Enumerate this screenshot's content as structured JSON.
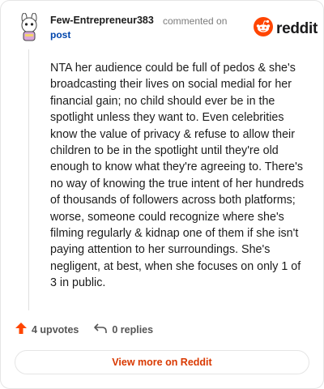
{
  "header": {
    "username": "Few-Entrepreneur383",
    "action_text": "commented on",
    "post_link": "post",
    "avatar_icon": "snoo-avatar-icon",
    "brand_icon": "reddit-snoo-icon",
    "brand_text": "reddit"
  },
  "comment": {
    "body": "NTA her audience could be full of pedos & she's broadcasting their lives on social medial for her financial gain; no child should ever be in the spotlight unless they want to. Even celebrities know the value of privacy & refuse to allow their children to be in the spotlight until they're old enough to know what they're agreeing to. There's no way of knowing the true intent of her hundreds of thousands of followers across both platforms; worse, someone could recognize where she's filming regularly & kidnap one of them if she isn't paying attention to her surroundings. She's negligent, at best, when she focuses on only 1 of 3 in public."
  },
  "actions": {
    "upvotes_label": "4 upvotes",
    "replies_label": "0 replies",
    "upvote_icon": "upvote-arrow-icon",
    "reply_icon": "reply-arrow-icon"
  },
  "footer": {
    "view_more_label": "View more on Reddit"
  },
  "colors": {
    "brand_orange": "#ff4500",
    "link_blue": "#0045ac",
    "cta_orange": "#d93900"
  }
}
